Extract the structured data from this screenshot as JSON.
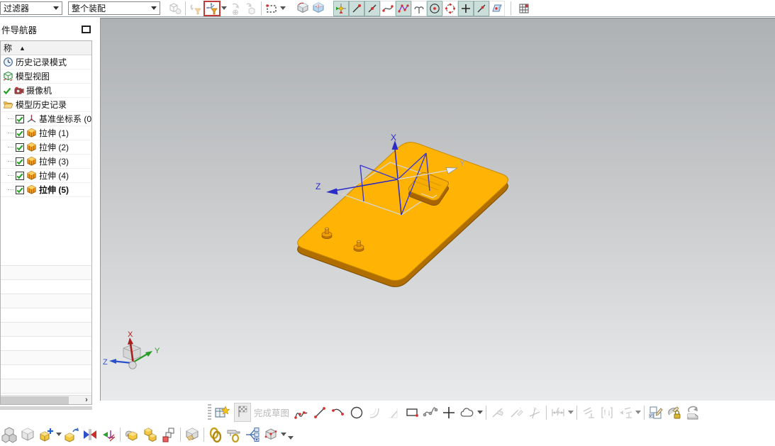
{
  "top_toolbar": {
    "filter_dropdown": "过滤器",
    "scope_dropdown": "整个装配",
    "icon_names": [
      "find-component",
      "previous-selection-filter",
      "snap-point-filter",
      "redo-filter",
      "copy-to-component",
      "rectangle-select",
      "shaded-cube",
      "translucent-cube",
      "enable-snap-point",
      "end-point-snap",
      "mid-point-snap",
      "control-point-snap",
      "intersection-snap",
      "tangent-snap",
      "circle-center-snap",
      "quadrant-snap",
      "existing-point-snap",
      "point-on-curve-snap",
      "point-on-face-snap",
      "grid-point-snap"
    ]
  },
  "navigator": {
    "title": "件导航器",
    "name_column": "称",
    "sort_indicator": "▲",
    "scroll_arrow": "›",
    "items": [
      {
        "label": "历史记录模式"
      },
      {
        "label": "模型视图"
      },
      {
        "label": "摄像机"
      },
      {
        "label": "模型历史记录"
      },
      {
        "label": "基准坐标系 (0"
      },
      {
        "label": "拉伸 (1)"
      },
      {
        "label": "拉伸 (2)"
      },
      {
        "label": "拉伸 (3)"
      },
      {
        "label": "拉伸 (4)"
      },
      {
        "label": "拉伸 (5)"
      }
    ]
  },
  "viewport": {
    "axes": {
      "x": "X",
      "y": "Y",
      "z": "Z"
    },
    "triad": {
      "x": "X",
      "y": "Y",
      "z": "Z"
    },
    "colors": {
      "plate_top": "#FFB405",
      "plate_side": "#B87200",
      "sketch_blue": "#3A3AD0",
      "background_top": "#AEB1B4",
      "background_bottom": "#E9EAEB"
    }
  },
  "sketch_toolbar": {
    "finish_sketch_label": "完成草图",
    "icon_names": [
      "sketch-in-task",
      "finish-sketch-flag",
      "profile",
      "line",
      "arc",
      "circle",
      "fillet",
      "chamfer",
      "rectangle",
      "studio-spline",
      "point",
      "offset-curve",
      "quick-trim",
      "quick-extend",
      "make-corner",
      "rapid-dimension",
      "geometric-constraint",
      "auto-constrain",
      "display-constraints",
      "edit-defining-section",
      "delayed-update-lock",
      "update-model"
    ]
  },
  "assembly_toolbar": {
    "icon_names": [
      "assemblies",
      "component-cube",
      "add-component",
      "move-component",
      "assembly-constraints",
      "show-degrees-of-freedom",
      "wave-geometry-linker",
      "pattern-component",
      "mirror-assembly",
      "exploded-views",
      "remember-constraints",
      "tool-ring",
      "assembly-sequence",
      "reference-set"
    ]
  }
}
